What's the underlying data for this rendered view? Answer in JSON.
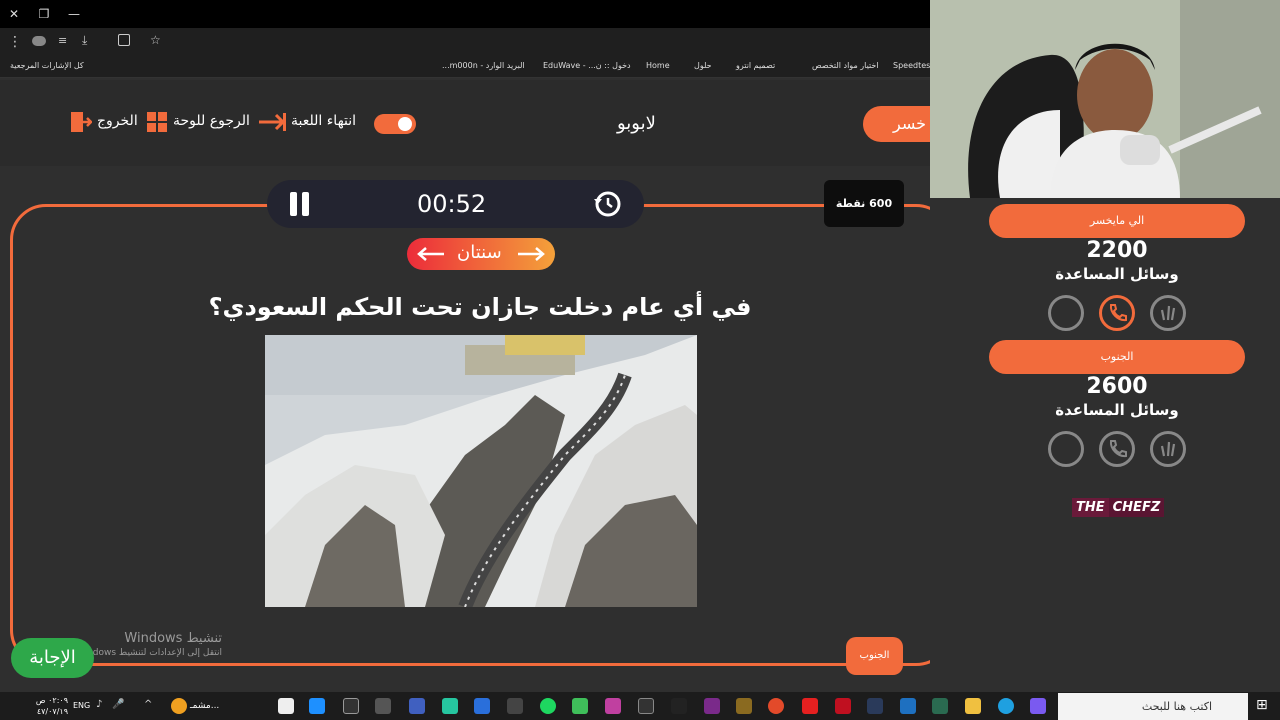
{
  "browser": {
    "bookmarks": [
      "Speedtest",
      "اختيار مواد التخصص",
      "تصميم انترو",
      "حلول",
      "Home",
      "دخول :: ن... - EduWave",
      "البريد الوارد - m000n...",
      "كل الإشارات المرجعية"
    ]
  },
  "game": {
    "actions": {
      "exit": "الخروج",
      "back_to_board": "الرجوع للوحة",
      "end_game": "انتهاء اللعبة"
    },
    "game_title": "لابوبو",
    "team_tab_partial": "خسر",
    "timer": "00:52",
    "points": "600 نقطة",
    "category": "سنتان",
    "question": "في أي عام دخلت جازان تحت الحكم السعودي؟",
    "current_team": "الجنوب",
    "answer_button": "الإجابة",
    "watermark_title": "تنشيط Windows",
    "watermark_sub": "انتقل إلى الإعدادات لتنشيط Windows."
  },
  "teams": [
    {
      "name": "الي مايخسر",
      "score": "2200",
      "helpers_label": "وسائل المساعدة"
    },
    {
      "name": "الجنوب",
      "score": "2600",
      "helpers_label": "وسائل المساعدة"
    }
  ],
  "sponsor": {
    "the": "THE",
    "chefz": "CHEFZ"
  },
  "taskbar": {
    "search_placeholder": "اكتب هنا للبحث",
    "lang": "ENG",
    "time": "٠٢:٠٩ ص",
    "date": "٤٧/٠٧/١٩",
    "weather": "مشمـ..."
  },
  "colors": {
    "accent": "#f26b3c",
    "answer": "#2ea84a",
    "background": "#2f2f2f"
  }
}
